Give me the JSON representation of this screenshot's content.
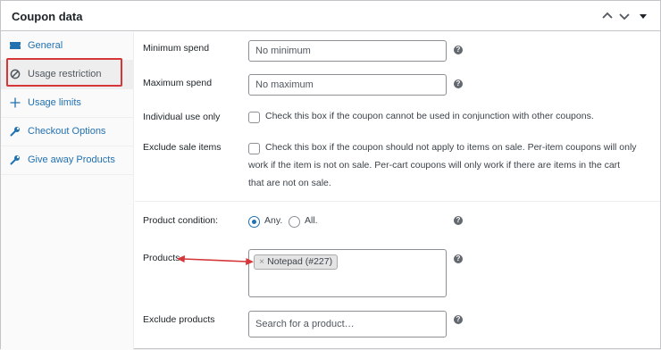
{
  "panel": {
    "title": "Coupon data"
  },
  "sidebar": {
    "items": [
      {
        "label": "General",
        "icon": "ticket-icon"
      },
      {
        "label": "Usage restriction",
        "icon": "block-icon"
      },
      {
        "label": "Usage limits",
        "icon": "plus-move-icon"
      },
      {
        "label": "Checkout Options",
        "icon": "wrench-icon"
      },
      {
        "label": "Give away Products",
        "icon": "wrench-icon"
      }
    ],
    "active_index": 1
  },
  "fields": {
    "min_spend": {
      "label": "Minimum spend",
      "placeholder": "No minimum"
    },
    "max_spend": {
      "label": "Maximum spend",
      "placeholder": "No maximum"
    },
    "individual_use": {
      "label": "Individual use only",
      "text": "Check this box if the coupon cannot be used in conjunction with other coupons."
    },
    "exclude_sale": {
      "label": "Exclude sale items",
      "line1": "Check this box if the coupon should not apply to items on sale. Per-item coupons will only",
      "line2": "work if the item is not on sale. Per-cart coupons will only work if there are items in the cart",
      "line3": "that are not on sale."
    },
    "product_condition": {
      "label": "Product condition:",
      "options": [
        "Any.",
        "All."
      ],
      "selected": "Any."
    },
    "products": {
      "label": "Products",
      "selected": [
        {
          "name": "Notepad (#227)",
          "remove": "×"
        }
      ]
    },
    "exclude_products": {
      "label": "Exclude products",
      "placeholder": "Search for a product…"
    },
    "help_glyph": "?"
  },
  "colors": {
    "accent": "#2271b1",
    "highlight": "#d63638"
  }
}
